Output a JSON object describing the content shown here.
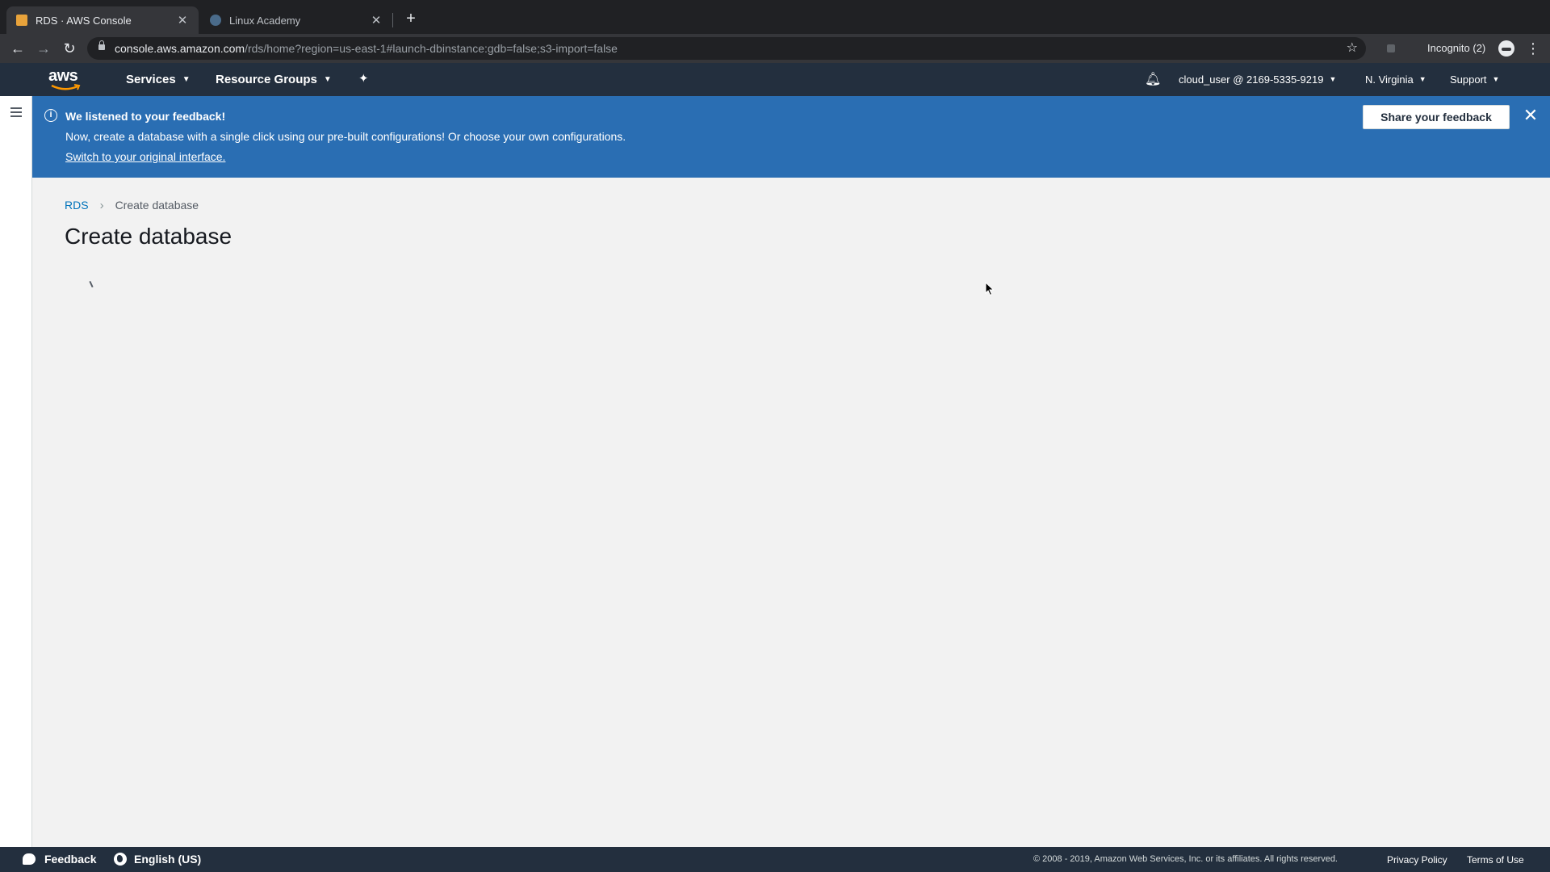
{
  "browser": {
    "tabs": [
      {
        "title": "RDS · AWS Console",
        "active": true
      },
      {
        "title": "Linux Academy",
        "active": false
      }
    ],
    "url_host": "console.aws.amazon.com",
    "url_path": "/rds/home?region=us-east-1#launch-dbinstance:gdb=false;s3-import=false",
    "incognito_label": "Incognito (2)"
  },
  "aws_nav": {
    "logo_text": "aws",
    "services_label": "Services",
    "resource_groups_label": "Resource Groups",
    "account_label": "cloud_user @ 2169-5335-9219",
    "region_label": "N. Virginia",
    "support_label": "Support"
  },
  "banner": {
    "title": "We listened to your feedback!",
    "message": "Now, create a database with a single click using our pre-built configurations! Or choose your own configurations.",
    "link": "Switch to your original interface.",
    "button": "Share your feedback",
    "color": "#2a6eb3"
  },
  "content": {
    "breadcrumb_root": "RDS",
    "breadcrumb_current": "Create database",
    "title": "Create database"
  },
  "footer": {
    "feedback_label": "Feedback",
    "language_label": "English (US)",
    "copyright": "© 2008 - 2019, Amazon Web Services, Inc. or its affiliates. All rights reserved.",
    "privacy_label": "Privacy Policy",
    "terms_label": "Terms of Use"
  }
}
